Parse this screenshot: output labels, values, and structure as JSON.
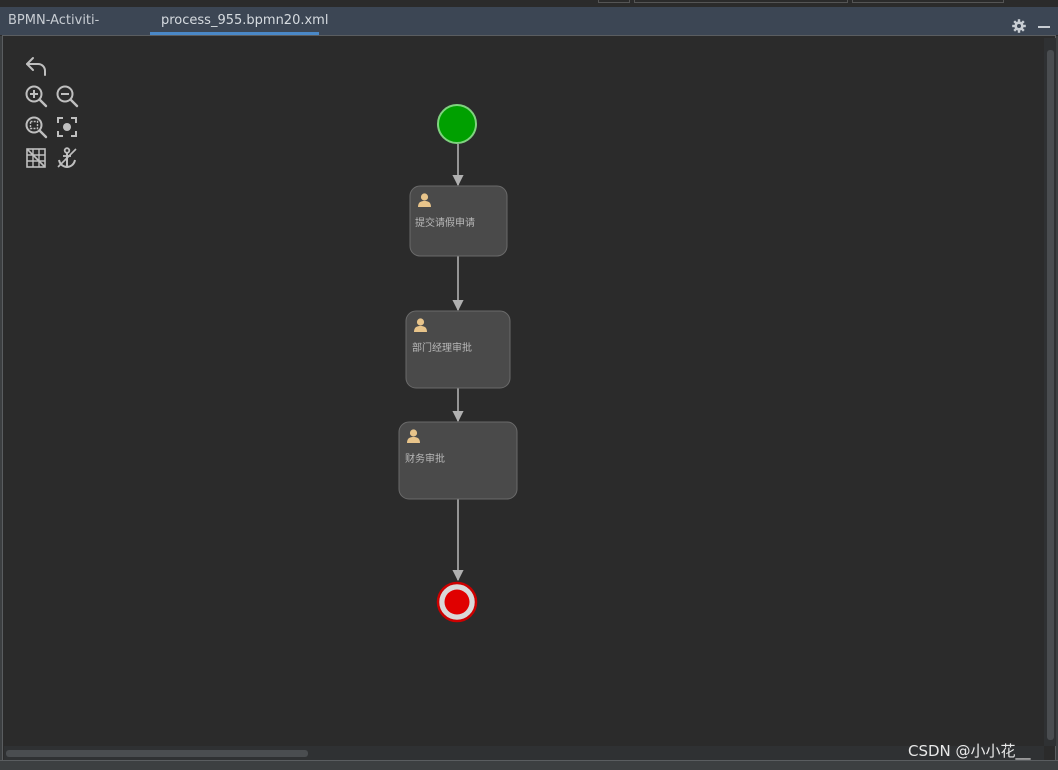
{
  "tabs": [
    {
      "label": "BPMN-Activiti-Diagram",
      "active": false
    },
    {
      "label": "process_955.bpmn20.xml",
      "active": true
    }
  ],
  "toolbar": {
    "icons": [
      "undo-icon",
      "zoom-in-icon",
      "zoom-out-icon",
      "zoom-fit-icon",
      "center-icon",
      "grid-icon",
      "anchor-icon"
    ]
  },
  "diagram": {
    "start_event": {
      "type": "start",
      "color": "#00a000"
    },
    "tasks": [
      {
        "label": "提交请假申请",
        "icon": "user-icon"
      },
      {
        "label": "部门经理审批",
        "icon": "user-icon"
      },
      {
        "label": "财务审批",
        "icon": "user-icon"
      }
    ],
    "end_event": {
      "type": "end",
      "color": "#e00000"
    }
  },
  "colors": {
    "canvas": "#2b2b2b",
    "task_fill": "#4a4a4a",
    "task_border": "#6a6a6a",
    "flow": "#b0b0b0",
    "user_icon": "#e8c48a",
    "tab_accent": "#4a88c7"
  },
  "watermark": "CSDN @小小花__"
}
